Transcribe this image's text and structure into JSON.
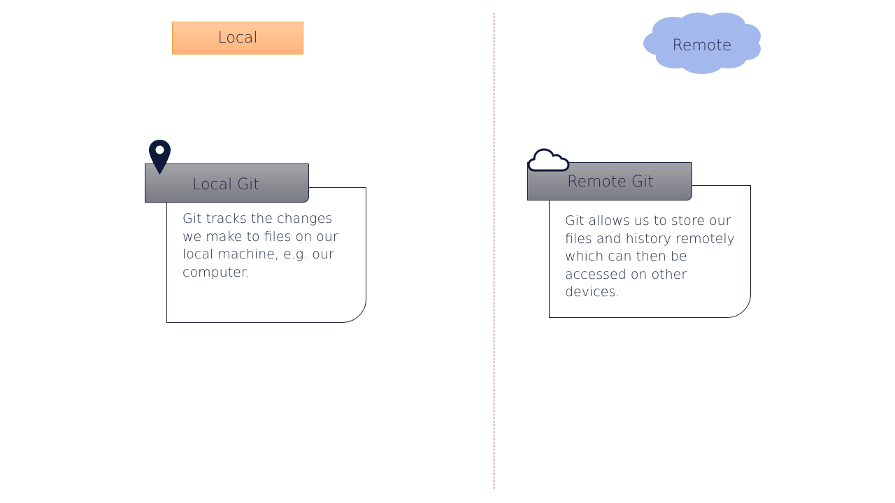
{
  "headers": {
    "local": "Local",
    "remote": "Remote"
  },
  "local_card": {
    "title": "Local Git",
    "body": "Git tracks the changes we make to files on our local machine, e.g. our computer.",
    "icon": "map-pin-icon"
  },
  "remote_card": {
    "title": "Remote Git",
    "body": "Git allows us to store our files and history remotely which can then be accessed on other devices.",
    "icon": "cloud-outline-icon"
  },
  "colors": {
    "divider": "#c0283a",
    "local_header_fill": "#ffb47a",
    "remote_cloud_fill": "#a3b8ec",
    "tab_fill": "#8c8e94",
    "ink": "#1f2540"
  }
}
